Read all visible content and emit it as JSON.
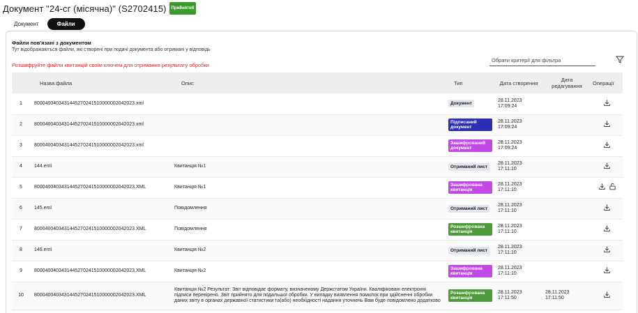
{
  "header": {
    "title": "Документ \"24-сг (місячна)\" (S2702415)",
    "status": "Прийнятий"
  },
  "tabs": [
    {
      "label": "Документ",
      "active": false
    },
    {
      "label": "Файли",
      "active": true
    }
  ],
  "section": {
    "title": "Файли пов'язані з документом",
    "subtitle": "Тут відображаються файли, які створені при подачі документа або отримані у відповідь",
    "warning": "Розшифруйте файли квитанцій своїм ключем для отримання результату обробки"
  },
  "filter": {
    "placeholder": "Обрати критерії для фільтра",
    "icon": "filter-icon"
  },
  "table": {
    "columns": {
      "num": "",
      "name": "Назва файла",
      "desc": "Опис",
      "type": "Тип",
      "created": "Дата створення",
      "edited": "Дата редагування",
      "ops": "Операції"
    },
    "rows": [
      {
        "num": "1",
        "name": "8000400403431445270241510000002042023.xml",
        "desc": "",
        "type": "Документ",
        "type_color": "#e3e6ec",
        "created": "28.11.2023 17:09:24",
        "edited": "",
        "ops": [
          "download-icon"
        ]
      },
      {
        "num": "2",
        "name": "8000400403431445270241510000002042023.xml",
        "desc": "",
        "type": "Підписаний документ",
        "type_color": "#2c2fb3",
        "created": "28.11.2023 17:09:24",
        "edited": "",
        "ops": [
          "download-icon"
        ]
      },
      {
        "num": "3",
        "name": "8000400403431445270241510000002042023.xml",
        "desc": "",
        "type": "Зашифрований документ",
        "type_color": "#c149e6",
        "created": "28.11.2023 17:09:24",
        "edited": "",
        "ops": [
          "download-icon"
        ]
      },
      {
        "num": "4",
        "name": "144.eml",
        "desc": "Квитанція №1",
        "type": "Отриманий лист",
        "type_color": "#e3e6ec",
        "created": "28.11.2023 17:11:10",
        "edited": "",
        "ops": [
          "download-icon"
        ]
      },
      {
        "num": "5",
        "name": "8000400403431445270241510000002042023.XML",
        "desc": "Квитанція №1",
        "type": "Зашифрована квитанція",
        "type_color": "#c149e6",
        "created": "28.11.2023 17:11:10",
        "edited": "",
        "ops": [
          "download-icon",
          "unlock-icon"
        ]
      },
      {
        "num": "6",
        "name": "145.eml",
        "desc": "Повідомлення",
        "type": "Отриманий лист",
        "type_color": "#e3e6ec",
        "created": "28.11.2023 17:11:10",
        "edited": "",
        "ops": [
          "download-icon"
        ]
      },
      {
        "num": "7",
        "name": "8000400403431445270241510000002042023.XML",
        "desc": "Повідомлення",
        "type": "Розшифрована квитанція",
        "type_color": "#4f9a3a",
        "created": "28.11.2023 17:11:10",
        "edited": "",
        "ops": [
          "download-icon"
        ]
      },
      {
        "num": "8",
        "name": "146.eml",
        "desc": "Квитанція №2",
        "type": "Отриманий лист",
        "type_color": "#e3e6ec",
        "created": "28.11.2023 17:11:10",
        "edited": "",
        "ops": [
          "download-icon"
        ]
      },
      {
        "num": "9",
        "name": "8000400403431445270241510000002042023.XML",
        "desc": "Квитанція №2",
        "type": "Зашифрована квитанція",
        "type_color": "#c149e6",
        "created": "28.11.2023 17:11:10",
        "edited": "",
        "ops": [
          "download-icon"
        ]
      },
      {
        "num": "10",
        "name": "8000400403431445270241510000002042023.XML",
        "desc": "Квитанція №2 Результат: Звіт відповідає формату, визначеному Держстатом України. Кваліфіковані електронні підписи перевірено. Звіт прийнято для подальшої обробки. У випадку виявлення помилок при здійсненні обробки даних звіту в органах державної статистики та(або) необхідності надання уточнень Вам буде повідомлено додатково",
        "type": "Розшифрована квитанція",
        "type_color": "#4f9a3a",
        "created": "28.11.2023 17:11:50",
        "edited": "28.11.2023 17:11:50",
        "ops": [
          "download-icon"
        ]
      }
    ]
  }
}
